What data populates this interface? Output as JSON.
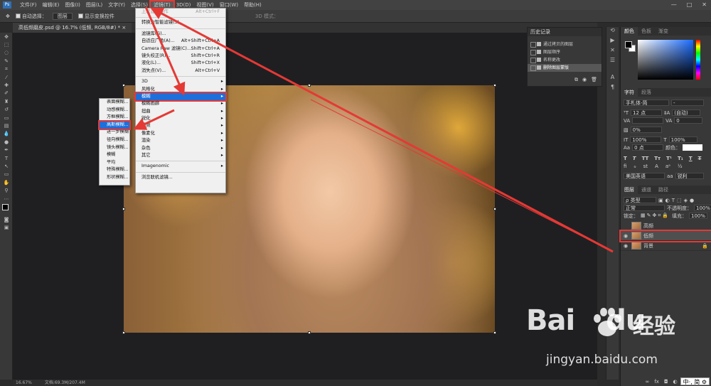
{
  "menubar": {
    "logo": "Ps",
    "items": [
      "文件(F)",
      "编辑(E)",
      "图像(I)",
      "图层(L)",
      "文字(Y)",
      "选择(S)",
      "滤镜(T)",
      "3D(D)",
      "视图(V)",
      "窗口(W)",
      "帮助(H)"
    ]
  },
  "options": {
    "auto_select": "自动选择：",
    "layer_drop": "图层",
    "show_transform": "显示变换控件",
    "mode3d": "3D 模式："
  },
  "tab": {
    "title": "高低频磨皮.psd @ 16.7% (低频, RGB/8#) *",
    "close": "×"
  },
  "status": {
    "zoom": "16.67%",
    "doc": "文档:69.3M/207.4M"
  },
  "filter_menu": {
    "items": [
      {
        "label": "上次滤镜操作",
        "shortcut": "Alt+Ctrl+F",
        "disabled": true
      },
      {
        "sep": true
      },
      {
        "label": "转换为智能滤镜(S)"
      },
      {
        "sep": true
      },
      {
        "label": "滤镜库(G)..."
      },
      {
        "label": "自适应广角(A)...",
        "shortcut": "Alt+Shift+Ctrl+A"
      },
      {
        "label": "Camera Raw 滤镜(C)...",
        "shortcut": "Shift+Ctrl+A"
      },
      {
        "label": "镜头校正(R)...",
        "shortcut": "Shift+Ctrl+R"
      },
      {
        "label": "液化(L)...",
        "shortcut": "Shift+Ctrl+X"
      },
      {
        "label": "消失点(V)...",
        "shortcut": "Alt+Ctrl+V"
      },
      {
        "sep": true
      },
      {
        "label": "3D",
        "sub": true
      },
      {
        "label": "风格化",
        "sub": true
      },
      {
        "label": "模糊",
        "sub": true,
        "highlight": true
      },
      {
        "label": "模糊画廊",
        "sub": true
      },
      {
        "label": "扭曲",
        "sub": true
      },
      {
        "label": "锐化",
        "sub": true
      },
      {
        "label": "视频",
        "sub": true
      },
      {
        "label": "像素化",
        "sub": true
      },
      {
        "label": "渲染",
        "sub": true
      },
      {
        "label": "杂色",
        "sub": true
      },
      {
        "label": "其它",
        "sub": true
      },
      {
        "sep": true
      },
      {
        "label": "Imagenomic",
        "sub": true
      },
      {
        "sep": true
      },
      {
        "label": "浏览联机滤镜..."
      }
    ]
  },
  "blur_menu": {
    "items": [
      "表面模糊...",
      "动感模糊...",
      "方框模糊...",
      "高斯模糊...",
      "进一步模糊",
      "径向模糊...",
      "镜头模糊...",
      "模糊",
      "平均",
      "特殊模糊...",
      "形状模糊..."
    ],
    "highlight_index": 3
  },
  "history": {
    "title": "历史记录",
    "items": [
      "通过拷贝的图层",
      "图层顺序",
      "名称更改",
      "删除图层蒙版"
    ],
    "selected_index": 3
  },
  "right": {
    "color_tabs": [
      "颜色",
      "色板",
      "渐变"
    ],
    "char_tabs": [
      "字符",
      "段落"
    ],
    "font": "手札体-简",
    "size": "12 点",
    "leading": "(自动)",
    "tracking": "0",
    "scale_v": "100%",
    "scale_h": "100%",
    "baseline": "0 点",
    "color_label": "颜色：",
    "pct": "0%",
    "lang": "美国英语",
    "aa": "锐利",
    "layer_tabs": [
      "图层",
      "通道",
      "路径"
    ],
    "kind": "ρ 类型",
    "blend": "正常",
    "opacity_label": "不透明度：",
    "opacity": "100%",
    "lock_label": "锁定：",
    "fill_label": "填充：",
    "fill": "100%",
    "layers": [
      {
        "name": "高频",
        "visible": false,
        "selected": false
      },
      {
        "name": "低频",
        "visible": true,
        "selected": true
      },
      {
        "name": "背景",
        "visible": true,
        "selected": false,
        "locked": true
      }
    ]
  },
  "watermark": {
    "brand": "Bai",
    "brand2": "du",
    "cn": "经验",
    "url": "jingyan.baidu.com"
  },
  "ime": "中·, 简 ⚙",
  "colors": {
    "accent": "#1e6fd9",
    "annotation": "#e53935"
  }
}
